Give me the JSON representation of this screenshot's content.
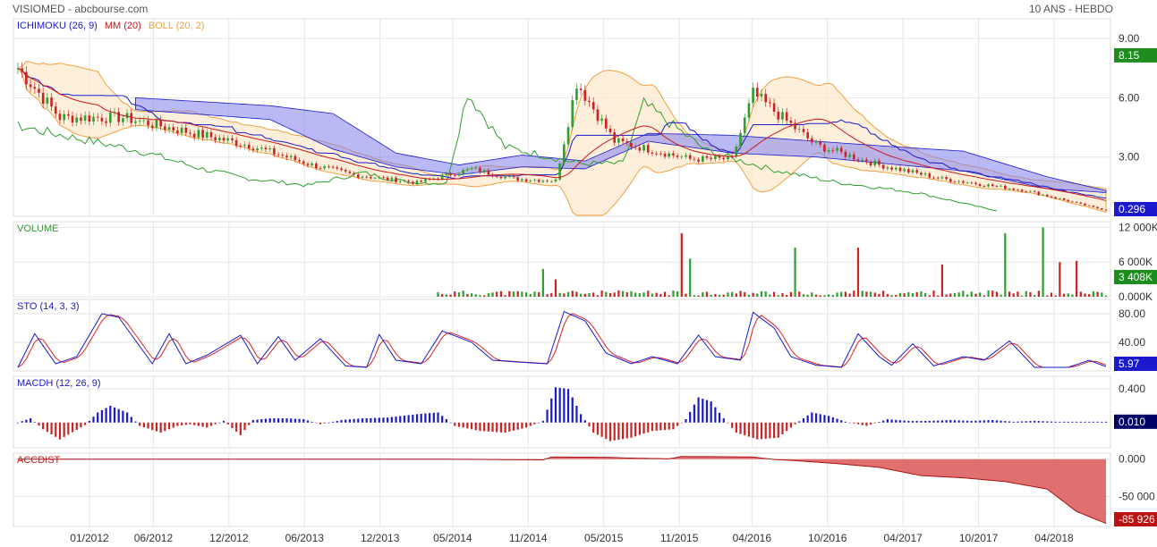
{
  "header": {
    "title": "VISIOMED - abcbourse.com",
    "period": "10 ANS - HEBDO"
  },
  "colors": {
    "ichimoku": "#1a1acc",
    "mm": "#cc1a1a",
    "boll": "#f0a040",
    "cloud": "#8080ee",
    "up": "#2e9e2e",
    "down": "#cc2222",
    "sto_k": "#1a1acc",
    "sto_d": "#dd2222",
    "accdist": "#e07070",
    "grid": "#e6e6e6"
  },
  "chart_data": [
    {
      "type": "line",
      "panel": "price",
      "legend": [
        {
          "label": "ICHIMOKU (26, 9)",
          "color": "#1a1acc"
        },
        {
          "label": "MM (20)",
          "color": "#cc1a1a"
        },
        {
          "label": "BOLL (20, 2)",
          "color": "#f0a040"
        }
      ],
      "yticks": [
        "9.00",
        "6.00",
        "3.00"
      ],
      "ytick_values": [
        9,
        6,
        3
      ],
      "ylim": [
        0,
        10
      ],
      "badges": [
        {
          "text": "8.15",
          "value": 8.15,
          "color": "#1e8c1e"
        },
        {
          "text": "0.296",
          "value": 0.296,
          "color": "#1a1acc"
        }
      ],
      "close_keyframes": [
        [
          0,
          7.5
        ],
        [
          10,
          5.0
        ],
        [
          25,
          5.0
        ],
        [
          40,
          4.3
        ],
        [
          55,
          3.6
        ],
        [
          70,
          2.6
        ],
        [
          80,
          2.1
        ],
        [
          95,
          1.7
        ],
        [
          108,
          2.4
        ],
        [
          118,
          1.9
        ],
        [
          128,
          1.8
        ],
        [
          133,
          6.8
        ],
        [
          142,
          3.8
        ],
        [
          160,
          2.9
        ],
        [
          170,
          2.9
        ],
        [
          175,
          6.2
        ],
        [
          190,
          3.6
        ],
        [
          205,
          2.6
        ],
        [
          220,
          1.9
        ],
        [
          240,
          1.3
        ],
        [
          259,
          0.3
        ]
      ],
      "cloud_top_keyframes": [
        [
          28,
          6.0
        ],
        [
          60,
          5.6
        ],
        [
          75,
          5.2
        ],
        [
          90,
          3.2
        ],
        [
          105,
          2.6
        ],
        [
          120,
          3.1
        ],
        [
          135,
          2.8
        ],
        [
          150,
          4.2
        ],
        [
          170,
          4.1
        ],
        [
          190,
          3.8
        ],
        [
          210,
          3.5
        ],
        [
          225,
          3.3
        ],
        [
          245,
          2.0
        ],
        [
          259,
          1.3
        ]
      ],
      "cloud_bot_keyframes": [
        [
          28,
          5.4
        ],
        [
          60,
          4.9
        ],
        [
          75,
          3.4
        ],
        [
          90,
          2.5
        ],
        [
          105,
          2.1
        ],
        [
          120,
          2.5
        ],
        [
          135,
          2.4
        ],
        [
          150,
          3.8
        ],
        [
          170,
          3.2
        ],
        [
          190,
          3.0
        ],
        [
          210,
          2.6
        ],
        [
          225,
          2.3
        ],
        [
          245,
          1.4
        ],
        [
          259,
          1.2
        ]
      ]
    },
    {
      "type": "bar",
      "panel": "volume",
      "legend": [
        {
          "label": "VOLUME",
          "color": "#2e9e2e"
        }
      ],
      "yticks": [
        "12 000K",
        "6 000K",
        "0.000K"
      ],
      "ytick_values": [
        12000,
        6000,
        0
      ],
      "ylim": [
        0,
        13000
      ],
      "badges": [
        {
          "text": "3 408K",
          "value": 3408,
          "color": "#1e8c1e"
        }
      ],
      "spikes": [
        [
          125,
          4800
        ],
        [
          128,
          3000
        ],
        [
          158,
          11000
        ],
        [
          160,
          6600
        ],
        [
          185,
          8500
        ],
        [
          200,
          8500
        ],
        [
          220,
          5600
        ],
        [
          235,
          11000
        ],
        [
          244,
          12000
        ],
        [
          248,
          6000
        ],
        [
          252,
          6200
        ]
      ]
    },
    {
      "type": "line",
      "panel": "stochastic",
      "legend": [
        {
          "label": "STO (14, 3, 3)",
          "color": "#1a1acc"
        }
      ],
      "yticks": [
        "80.00",
        "40.00"
      ],
      "ytick_values": [
        80,
        40
      ],
      "ylim": [
        0,
        100
      ],
      "badges": [
        {
          "text": "5.97",
          "value": 5.97,
          "color": "#1a1acc"
        }
      ],
      "keyframes": [
        [
          0,
          5
        ],
        [
          4,
          52
        ],
        [
          9,
          10
        ],
        [
          14,
          20
        ],
        [
          20,
          80
        ],
        [
          24,
          75
        ],
        [
          32,
          10
        ],
        [
          36,
          52
        ],
        [
          40,
          10
        ],
        [
          45,
          22
        ],
        [
          53,
          50
        ],
        [
          57,
          10
        ],
        [
          62,
          48
        ],
        [
          66,
          15
        ],
        [
          72,
          45
        ],
        [
          78,
          7
        ],
        [
          83,
          5
        ],
        [
          86,
          51
        ],
        [
          90,
          15
        ],
        [
          96,
          10
        ],
        [
          101,
          56
        ],
        [
          108,
          40
        ],
        [
          113,
          15
        ],
        [
          120,
          12
        ],
        [
          126,
          10
        ],
        [
          130,
          83
        ],
        [
          135,
          70
        ],
        [
          140,
          25
        ],
        [
          146,
          10
        ],
        [
          151,
          20
        ],
        [
          157,
          10
        ],
        [
          162,
          50
        ],
        [
          166,
          20
        ],
        [
          172,
          15
        ],
        [
          175,
          82
        ],
        [
          180,
          60
        ],
        [
          184,
          20
        ],
        [
          190,
          8
        ],
        [
          196,
          5
        ],
        [
          200,
          52
        ],
        [
          205,
          20
        ],
        [
          208,
          8
        ],
        [
          213,
          38
        ],
        [
          218,
          7
        ],
        [
          225,
          20
        ],
        [
          230,
          15
        ],
        [
          236,
          42
        ],
        [
          242,
          5
        ],
        [
          250,
          5
        ],
        [
          255,
          15
        ],
        [
          259,
          6
        ]
      ]
    },
    {
      "type": "bar",
      "panel": "macdh",
      "legend": [
        {
          "label": "MACDH (12, 26, 9)",
          "color": "#1a1acc"
        }
      ],
      "yticks": [
        "0.400"
      ],
      "ytick_values": [
        0.4
      ],
      "ylim": [
        -0.3,
        0.55
      ],
      "badges": [
        {
          "text": "0.010",
          "value": 0.01,
          "color": "#000066"
        }
      ],
      "keyframes": [
        [
          0,
          0
        ],
        [
          3,
          0.05
        ],
        [
          6,
          -0.08
        ],
        [
          10,
          -0.2
        ],
        [
          16,
          -0.03
        ],
        [
          19,
          0.12
        ],
        [
          22,
          0.2
        ],
        [
          26,
          0.12
        ],
        [
          29,
          -0.04
        ],
        [
          34,
          -0.12
        ],
        [
          38,
          -0.04
        ],
        [
          41,
          -0.02
        ],
        [
          45,
          -0.06
        ],
        [
          49,
          0.02
        ],
        [
          53,
          -0.15
        ],
        [
          56,
          0.03
        ],
        [
          60,
          0.05
        ],
        [
          64,
          0.05
        ],
        [
          68,
          0.04
        ],
        [
          72,
          -0.02
        ],
        [
          77,
          0.03
        ],
        [
          82,
          0.05
        ],
        [
          88,
          0.06
        ],
        [
          95,
          0.1
        ],
        [
          100,
          0.12
        ],
        [
          104,
          -0.04
        ],
        [
          110,
          -0.1
        ],
        [
          116,
          -0.12
        ],
        [
          121,
          -0.06
        ],
        [
          125,
          0.02
        ],
        [
          128,
          0.42
        ],
        [
          131,
          0.4
        ],
        [
          134,
          0.1
        ],
        [
          137,
          -0.12
        ],
        [
          141,
          -0.22
        ],
        [
          146,
          -0.18
        ],
        [
          151,
          -0.1
        ],
        [
          156,
          -0.08
        ],
        [
          159,
          0.04
        ],
        [
          162,
          0.3
        ],
        [
          165,
          0.25
        ],
        [
          168,
          0.05
        ],
        [
          171,
          -0.12
        ],
        [
          176,
          -0.2
        ],
        [
          181,
          -0.18
        ],
        [
          185,
          -0.02
        ],
        [
          189,
          0.12
        ],
        [
          193,
          0.08
        ],
        [
          197,
          0.01
        ],
        [
          202,
          -0.04
        ],
        [
          207,
          0.04
        ],
        [
          212,
          0.02
        ],
        [
          217,
          0.02
        ],
        [
          222,
          0.03
        ],
        [
          227,
          0.02
        ],
        [
          232,
          0.03
        ],
        [
          237,
          0.01
        ],
        [
          242,
          0.02
        ],
        [
          247,
          0.01
        ],
        [
          252,
          0.01
        ],
        [
          259,
          0.01
        ]
      ]
    },
    {
      "type": "area",
      "panel": "accdist",
      "legend": [
        {
          "label": "ACCDIST",
          "color": "#cc1a1a"
        }
      ],
      "yticks": [
        "0.000",
        "-50 000"
      ],
      "ytick_values": [
        0,
        -50000
      ],
      "ylim": [
        -90000,
        8000
      ],
      "badges": [
        {
          "text": "-85 926",
          "value": -85926,
          "color": "#bb1111"
        }
      ],
      "keyframes": [
        [
          0,
          0
        ],
        [
          100,
          0
        ],
        [
          125,
          -1000
        ],
        [
          127,
          2800
        ],
        [
          140,
          2500
        ],
        [
          145,
          1500
        ],
        [
          155,
          500
        ],
        [
          158,
          3500
        ],
        [
          165,
          3300
        ],
        [
          175,
          2800
        ],
        [
          180,
          -500
        ],
        [
          185,
          -2000
        ],
        [
          195,
          -6000
        ],
        [
          205,
          -11000
        ],
        [
          215,
          -22000
        ],
        [
          225,
          -25000
        ],
        [
          235,
          -30000
        ],
        [
          245,
          -40000
        ],
        [
          252,
          -70000
        ],
        [
          259,
          -85926
        ]
      ]
    }
  ],
  "xaxis": {
    "labels": [
      "01/2012",
      "06/2012",
      "12/2012",
      "06/2013",
      "12/2013",
      "05/2014",
      "11/2014",
      "05/2015",
      "11/2015",
      "04/2016",
      "10/2016",
      "04/2017",
      "10/2017",
      "04/2018"
    ],
    "label_index": [
      18,
      40,
      66,
      92,
      118,
      143,
      169,
      195,
      221,
      246,
      272,
      298,
      324,
      350
    ]
  }
}
